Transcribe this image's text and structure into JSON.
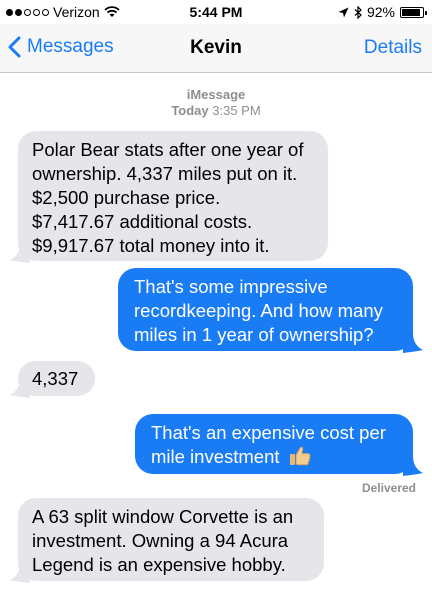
{
  "status": {
    "carrier": "Verizon",
    "time": "5:44 PM",
    "battery": "92%",
    "battery_level": 0.92
  },
  "nav": {
    "back_label": "Messages",
    "title": "Kevin",
    "details_label": "Details"
  },
  "thread": {
    "service": "iMessage",
    "date_label": "Today",
    "time_label": "3:35 PM"
  },
  "messages": [
    {
      "direction": "incoming",
      "lines": [
        "Polar Bear stats after one year of",
        "ownership.  4,337 miles put on it.",
        "$2,500 purchase price.",
        "$7,417.67 additional costs.",
        "$9,917.67 total money into it."
      ]
    },
    {
      "direction": "outgoing",
      "lines": [
        "That's some impressive",
        "recordkeeping. And how many",
        "miles in 1 year of ownership?"
      ]
    },
    {
      "direction": "incoming",
      "lines": [
        "4,337"
      ]
    },
    {
      "direction": "outgoing",
      "lines": [
        "That's an expensive cost per",
        "mile investment"
      ],
      "emoji": "thumbs-up"
    },
    {
      "direction": "incoming",
      "lines": [
        "A 63 split window Corvette is an",
        "investment.  Owning a 94 Acura",
        "Legend is an expensive hobby."
      ]
    }
  ],
  "delivered_label": "Delivered",
  "colors": {
    "accent": "#1a7cf5",
    "incoming_bubble": "#e5e5ea",
    "outgoing_bubble": "#1a7cf5"
  },
  "icons": [
    "signal-dots-icon",
    "wifi-icon",
    "location-arrow-icon",
    "bluetooth-icon",
    "battery-icon",
    "chevron-left-icon",
    "thumbs-up-emoji"
  ]
}
